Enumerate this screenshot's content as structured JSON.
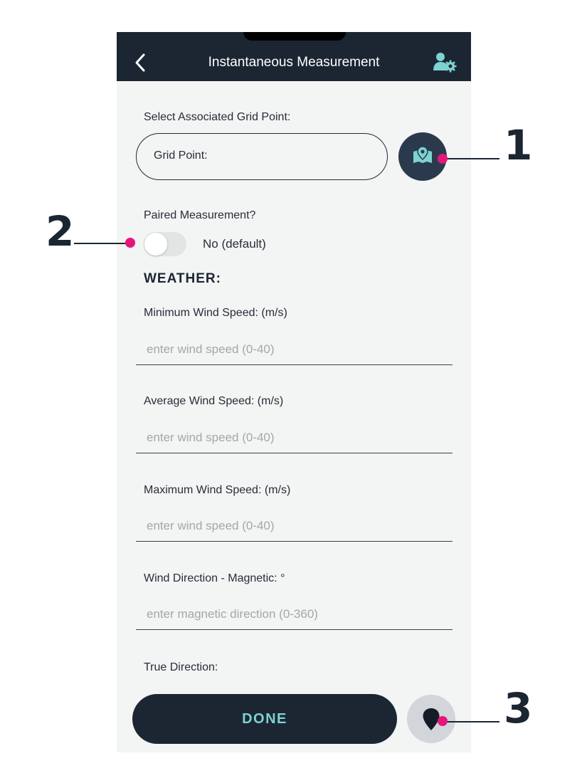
{
  "header": {
    "title": "Instantaneous Measurement",
    "back_icon": "chevron-left-icon",
    "profile_icon": "user-settings-icon"
  },
  "grid": {
    "label": "Select Associated Grid Point:",
    "input_text": "Grid Point:",
    "map_icon": "map-pin-icon"
  },
  "paired": {
    "label": "Paired Measurement?",
    "toggle_value": "No (default)"
  },
  "weather": {
    "heading": "WEATHER:",
    "fields": [
      {
        "label": "Minimum Wind Speed: (m/s)",
        "placeholder": "enter wind speed (0-40)"
      },
      {
        "label": "Average Wind Speed: (m/s)",
        "placeholder": "enter wind speed (0-40)"
      },
      {
        "label": "Maximum Wind Speed: (m/s)",
        "placeholder": "enter wind speed (0-40)"
      },
      {
        "label": "Wind Direction - Magnetic: °",
        "placeholder": "enter magnetic direction (0-360)"
      }
    ],
    "true_direction_label": "True Direction:"
  },
  "footer": {
    "done_label": "DONE",
    "location_icon": "location-pin-icon"
  },
  "callouts": [
    "1",
    "2",
    "3"
  ],
  "colors": {
    "header_bg": "#1b2632",
    "accent": "#7cd3d1",
    "callout_dot": "#e6157c",
    "screen_bg": "#f3f4f4"
  }
}
